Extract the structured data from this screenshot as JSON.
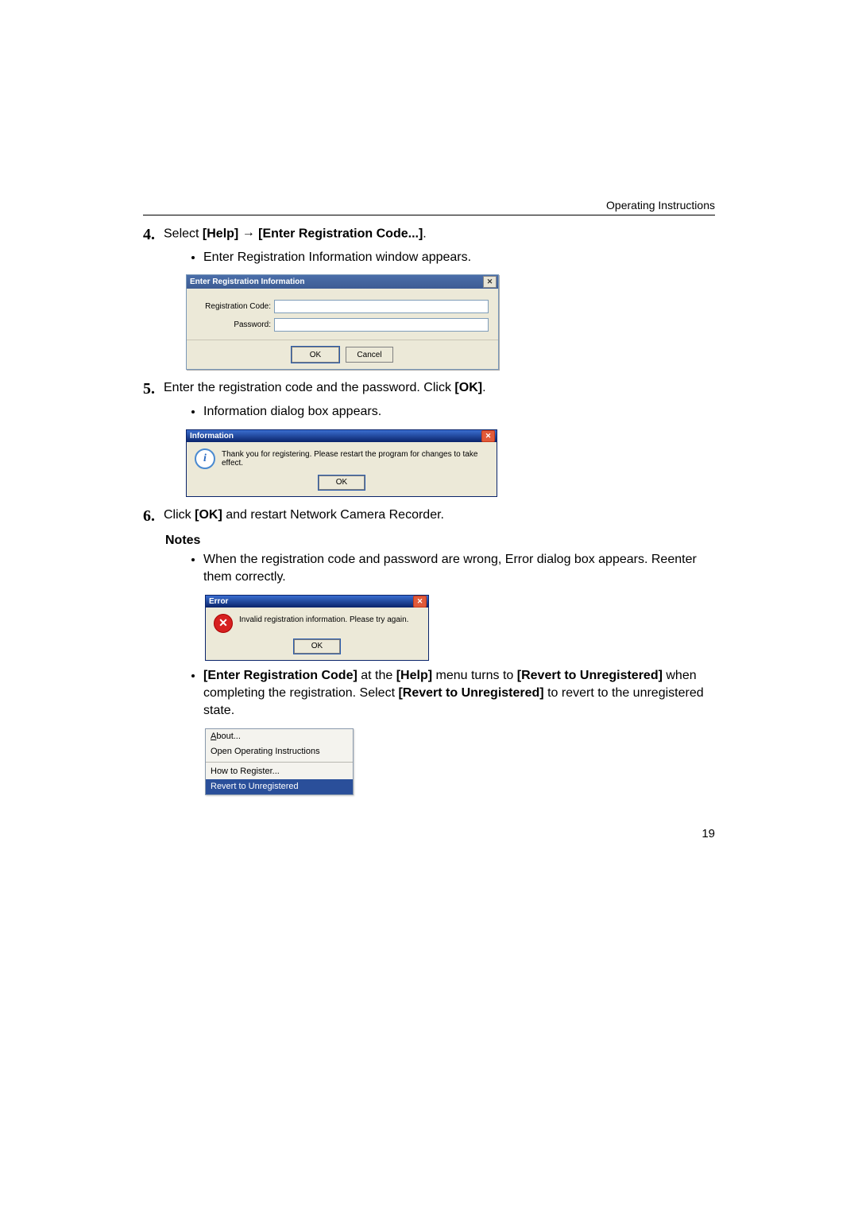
{
  "header": {
    "running": "Operating Instructions"
  },
  "steps": {
    "s4": {
      "num": "4.",
      "pre": "Select ",
      "b1": "[Help]",
      "arrow": "→",
      "b2": "[Enter Registration Code...]",
      "post": ".",
      "bullet1": "Enter Registration Information window appears."
    },
    "s5": {
      "num": "5.",
      "text_pre": "Enter the registration code and the password. Click ",
      "b1": "[OK]",
      "text_post": ".",
      "bullet1": "Information dialog box appears."
    },
    "s6": {
      "num": "6.",
      "text_pre": "Click ",
      "b1": "[OK]",
      "text_post": " and restart Network Camera Recorder."
    }
  },
  "notes": {
    "heading": "Notes",
    "n1": "When the registration code and password are wrong, Error dialog box appears. Reenter them correctly.",
    "n2": {
      "b1": "[Enter Registration Code]",
      "t1": " at the ",
      "b2": "[Help]",
      "t2": " menu turns to ",
      "b3": "[Revert to Unregistered]",
      "t3": " when completing the registration. Select ",
      "b4": "[Revert to Unregistered]",
      "t4": " to revert to the unregistered state."
    }
  },
  "dialog_reg": {
    "title": "Enter Registration Information",
    "label_code": "Registration Code:",
    "label_pass": "Password:",
    "ok": "OK",
    "cancel": "Cancel"
  },
  "dialog_info": {
    "title": "Information",
    "message": "Thank you for registering. Please restart the program for changes to take effect.",
    "ok": "OK"
  },
  "dialog_error": {
    "title": "Error",
    "message": "Invalid registration information. Please try again.",
    "ok": "OK"
  },
  "menu": {
    "about": "About...",
    "open_instr": "Open Operating Instructions",
    "how_register": "How to Register...",
    "revert": "Revert to Unregistered"
  },
  "footer": {
    "page": "19"
  }
}
